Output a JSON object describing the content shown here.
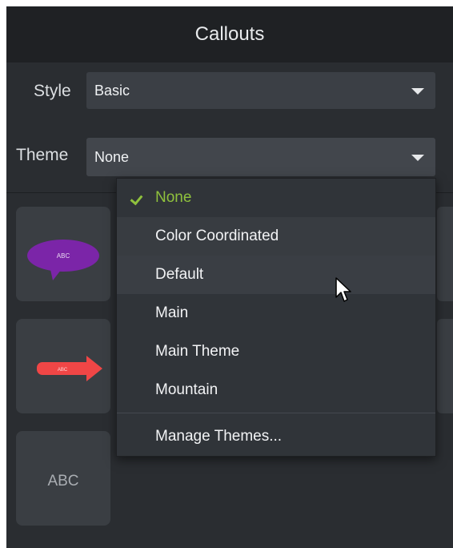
{
  "panel": {
    "title": "Callouts"
  },
  "style_row": {
    "label": "Style",
    "value": "Basic"
  },
  "theme_row": {
    "label": "Theme",
    "value": "None"
  },
  "tiles": [
    {
      "name": "speech-bubble-callout",
      "text": "ABC",
      "color": "#7b25a8"
    },
    {
      "name": "arrow-callout",
      "text": "ABC",
      "color": "#f04646"
    },
    {
      "name": "text-callout",
      "text": "ABC",
      "color": "#a9adb2"
    }
  ],
  "theme_menu": {
    "items": [
      {
        "label": "None",
        "selected": true
      },
      {
        "label": "Color Coordinated"
      },
      {
        "label": "Default",
        "hovered": true
      },
      {
        "label": "Main"
      },
      {
        "label": "Main Theme"
      },
      {
        "label": "Mountain"
      }
    ],
    "manage_label": "Manage Themes..."
  },
  "colors": {
    "background": "#2a2d31",
    "header": "#1f2124",
    "accent_check": "#8fc13d"
  }
}
